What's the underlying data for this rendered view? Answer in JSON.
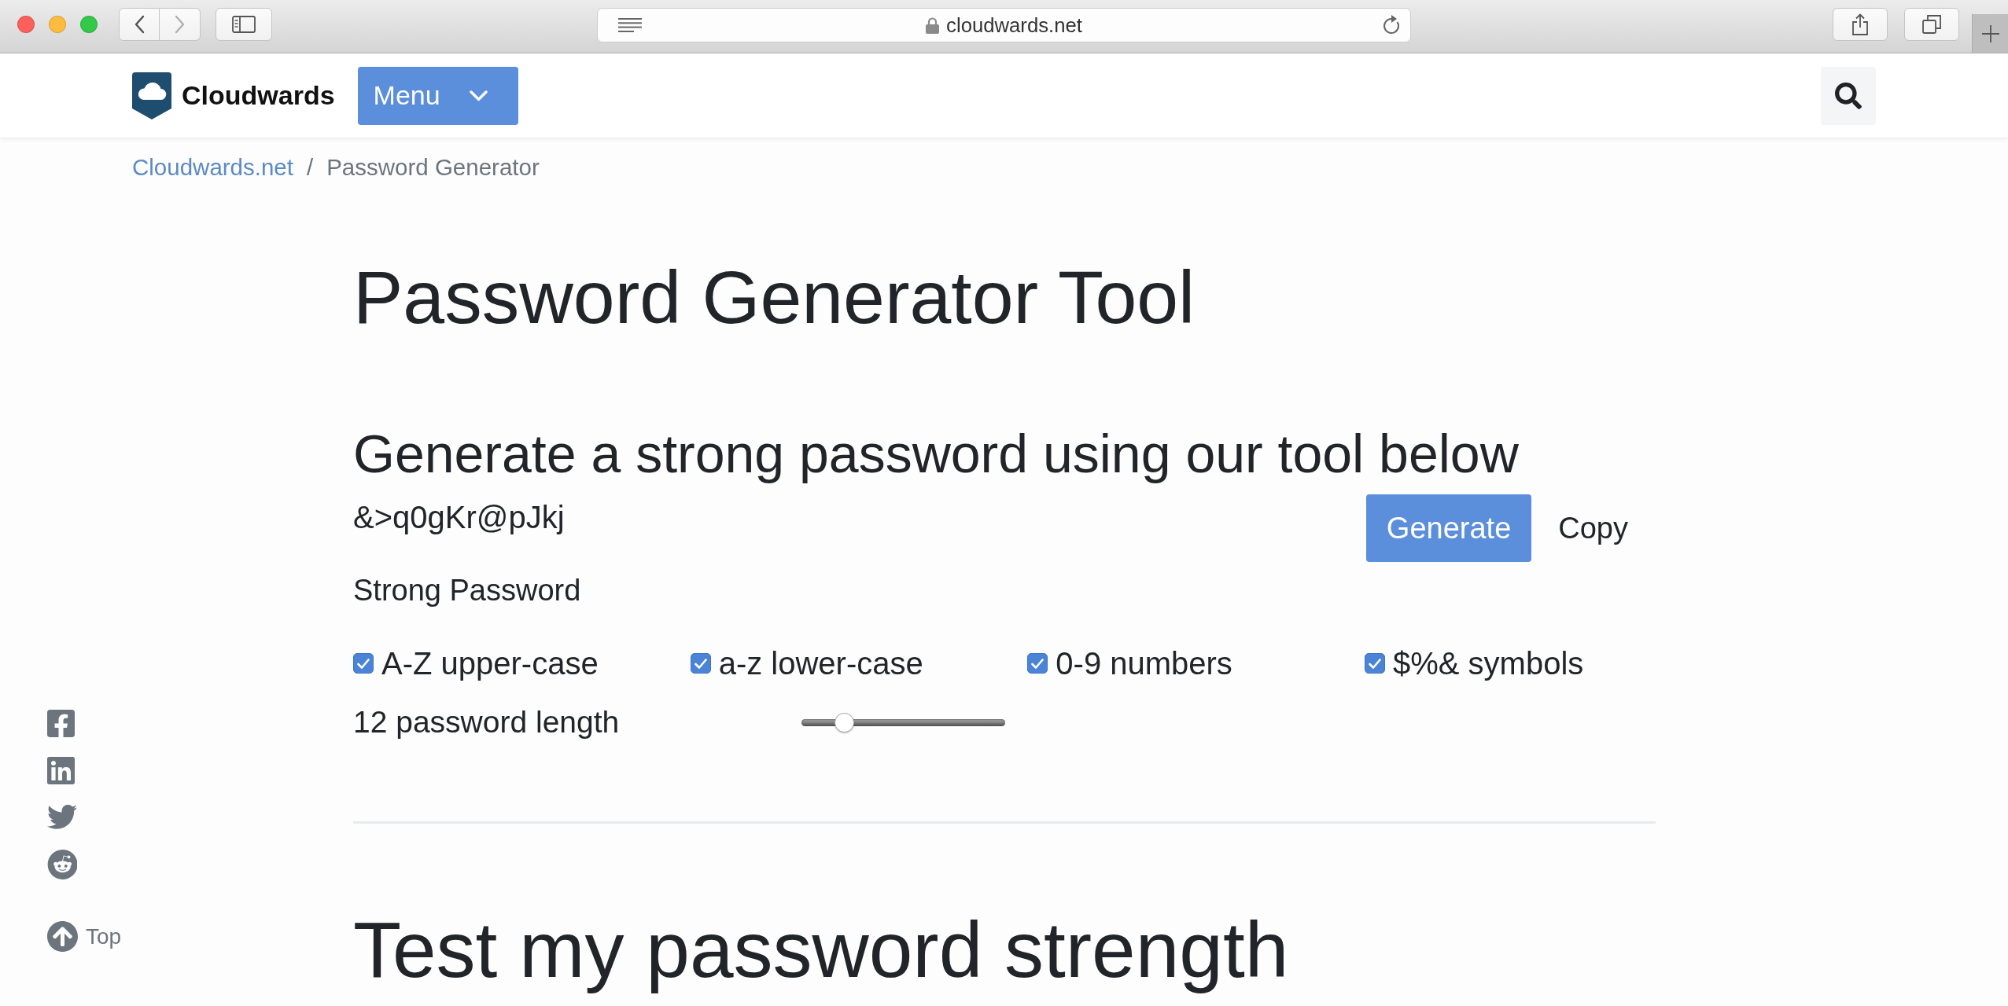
{
  "browser": {
    "address": "cloudwards.net",
    "forward_disabled": true
  },
  "header": {
    "logo_text": "Cloudwards",
    "menu_label": "Menu"
  },
  "breadcrumb": {
    "separator": "/",
    "items": [
      {
        "label": "Cloudwards.net",
        "kind": "link"
      },
      {
        "label": "Password Generator",
        "kind": "current"
      }
    ]
  },
  "page_title": "Password Generator Tool",
  "generator": {
    "heading": "Generate a strong password using our tool below",
    "password": "&>q0gKr@pJkj",
    "buttons": [
      {
        "label": "Generate",
        "kind": "primary"
      },
      {
        "label": "Copy",
        "kind": "plain"
      }
    ],
    "strength": "Strong Password",
    "options": [
      {
        "label": "A-Z upper-case",
        "checked": true
      },
      {
        "label": "a-z lower-case",
        "checked": true
      },
      {
        "label": "0-9 numbers",
        "checked": true
      },
      {
        "label": "$%& symbols",
        "checked": true
      }
    ],
    "length": {
      "label": "12 password length",
      "level": 0.21
    }
  },
  "next_section": {
    "title": "Test my password strength"
  },
  "share_bar": {
    "top_label": "Top"
  }
}
